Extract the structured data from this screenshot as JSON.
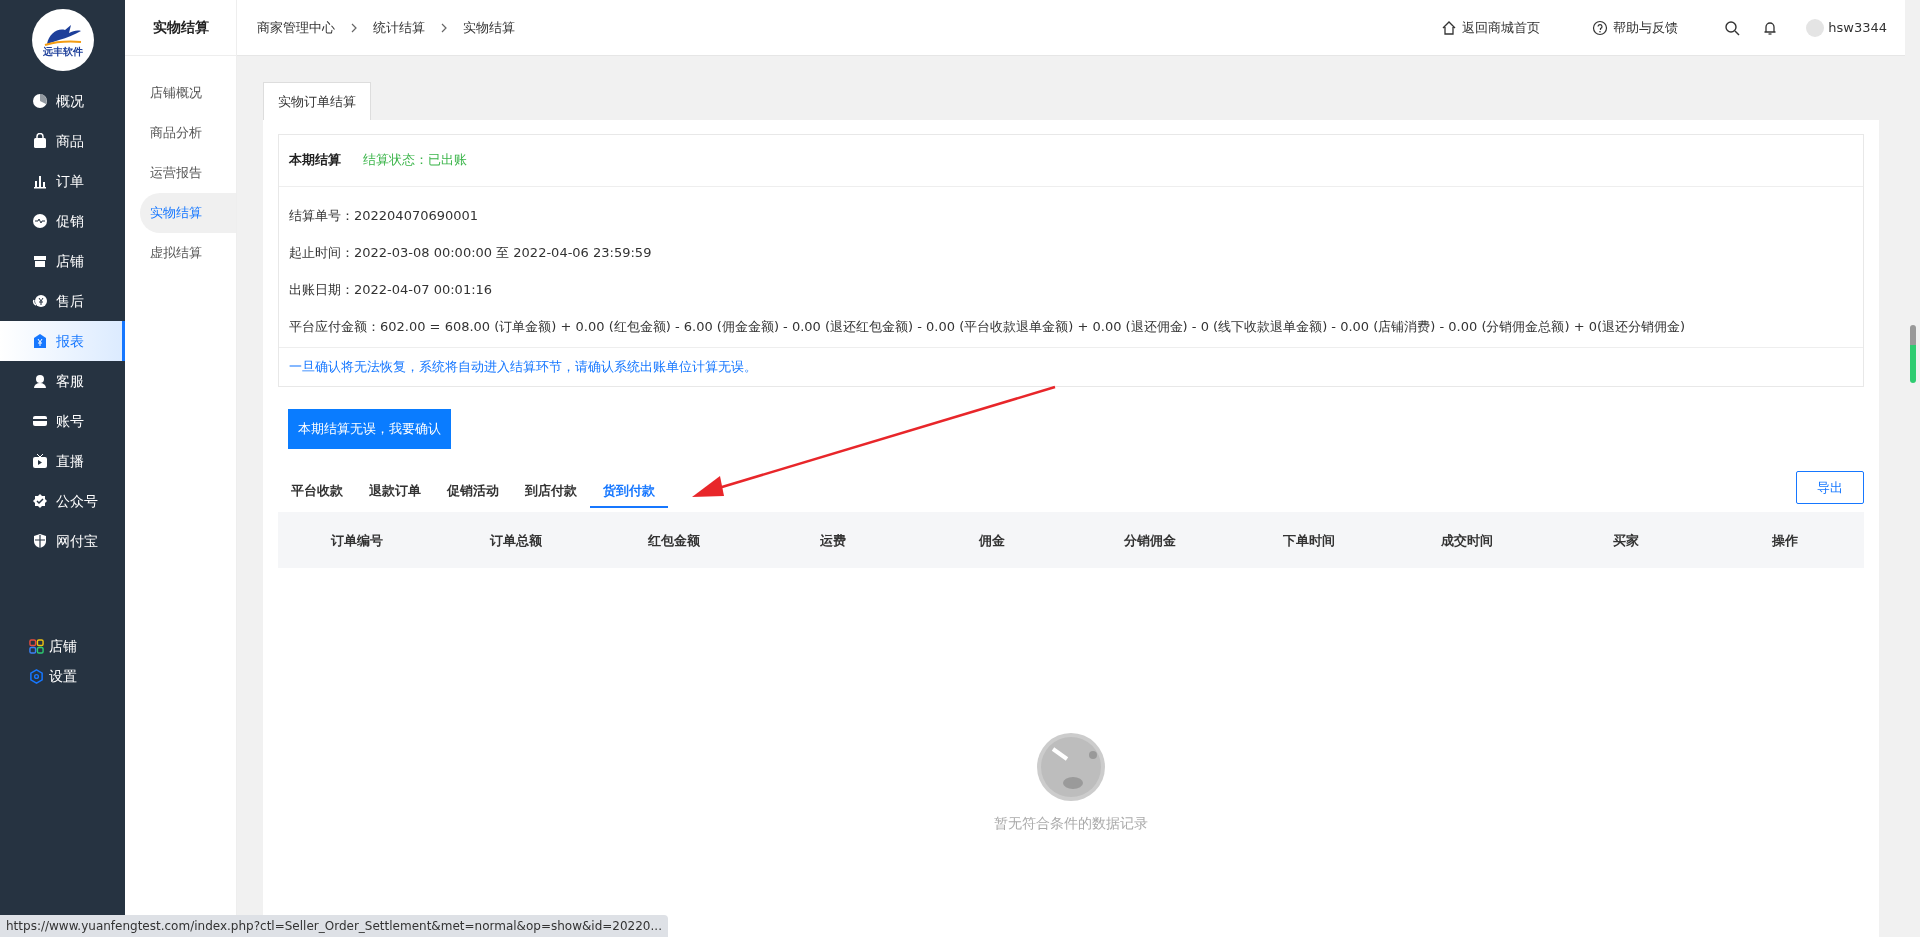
{
  "logo": {
    "text": "远丰软件"
  },
  "sidebar": {
    "items": [
      {
        "label": "概况",
        "selected": false
      },
      {
        "label": "商品",
        "selected": false
      },
      {
        "label": "订单",
        "selected": false
      },
      {
        "label": "促销",
        "selected": false
      },
      {
        "label": "店铺",
        "selected": false
      },
      {
        "label": "售后",
        "selected": false
      },
      {
        "label": "报表",
        "selected": true
      },
      {
        "label": "客服",
        "selected": false
      },
      {
        "label": "账号",
        "selected": false
      },
      {
        "label": "直播",
        "selected": false
      },
      {
        "label": "公众号",
        "selected": false
      },
      {
        "label": "网付宝",
        "selected": false
      }
    ],
    "bottom_items": [
      "店铺",
      "设置"
    ]
  },
  "subnav": {
    "title": "实物结算",
    "items": [
      {
        "label": "店铺概况",
        "selected": false
      },
      {
        "label": "商品分析",
        "selected": false
      },
      {
        "label": "运营报告",
        "selected": false
      },
      {
        "label": "实物结算",
        "selected": true
      },
      {
        "label": "虚拟结算",
        "selected": false
      }
    ]
  },
  "breadcrumb": [
    "商家管理中心",
    "统计结算",
    "实物结算"
  ],
  "header_links": [
    "返回商城首页",
    "帮助与反馈"
  ],
  "user": "hsw3344",
  "page_tabs": [
    "实物订单结算"
  ],
  "settlement": {
    "title": "本期结算",
    "status": "结算状态：已出账",
    "lines": [
      "结算单号：202204070690001",
      "起止时间：2022-03-08 00:00:00 至 2022-04-06 23:59:59",
      "出账日期：2022-04-07 00:01:16",
      "平台应付金额：602.00 = 608.00 (订单金额) + 0.00 (红包金额) - 6.00 (佣金金额) - 0.00 (退还红包金额) - 0.00 (平台收款退单金额) + 0.00 (退还佣金) - 0 (线下收款退单金额) - 0.00 (店铺消费) - 0.00 (分销佣金总额) + 0(退还分销佣金)"
    ],
    "notice": "一旦确认将无法恢复，系统将自动进入结算环节，请确认系统出账单位计算无误。"
  },
  "confirm_button": "本期结算无误，我要确认",
  "order_tabs": [
    {
      "label": "平台收款",
      "selected": false
    },
    {
      "label": "退款订单",
      "selected": false
    },
    {
      "label": "促销活动",
      "selected": false
    },
    {
      "label": "到店付款",
      "selected": false
    },
    {
      "label": "货到付款",
      "selected": true
    }
  ],
  "export_button": "导出",
  "table": {
    "columns": [
      "订单编号",
      "订单总额",
      "红包金额",
      "运费",
      "佣金",
      "分销佣金",
      "下单时间",
      "成交时间",
      "买家",
      "操作"
    ]
  },
  "empty_state": {
    "text": "暂无符合条件的数据记录"
  },
  "status_url": "https://www.yuanfengtest.com/index.php?ctl=Seller_Order_Settlement&met=normal&op=show&id=20220..."
}
